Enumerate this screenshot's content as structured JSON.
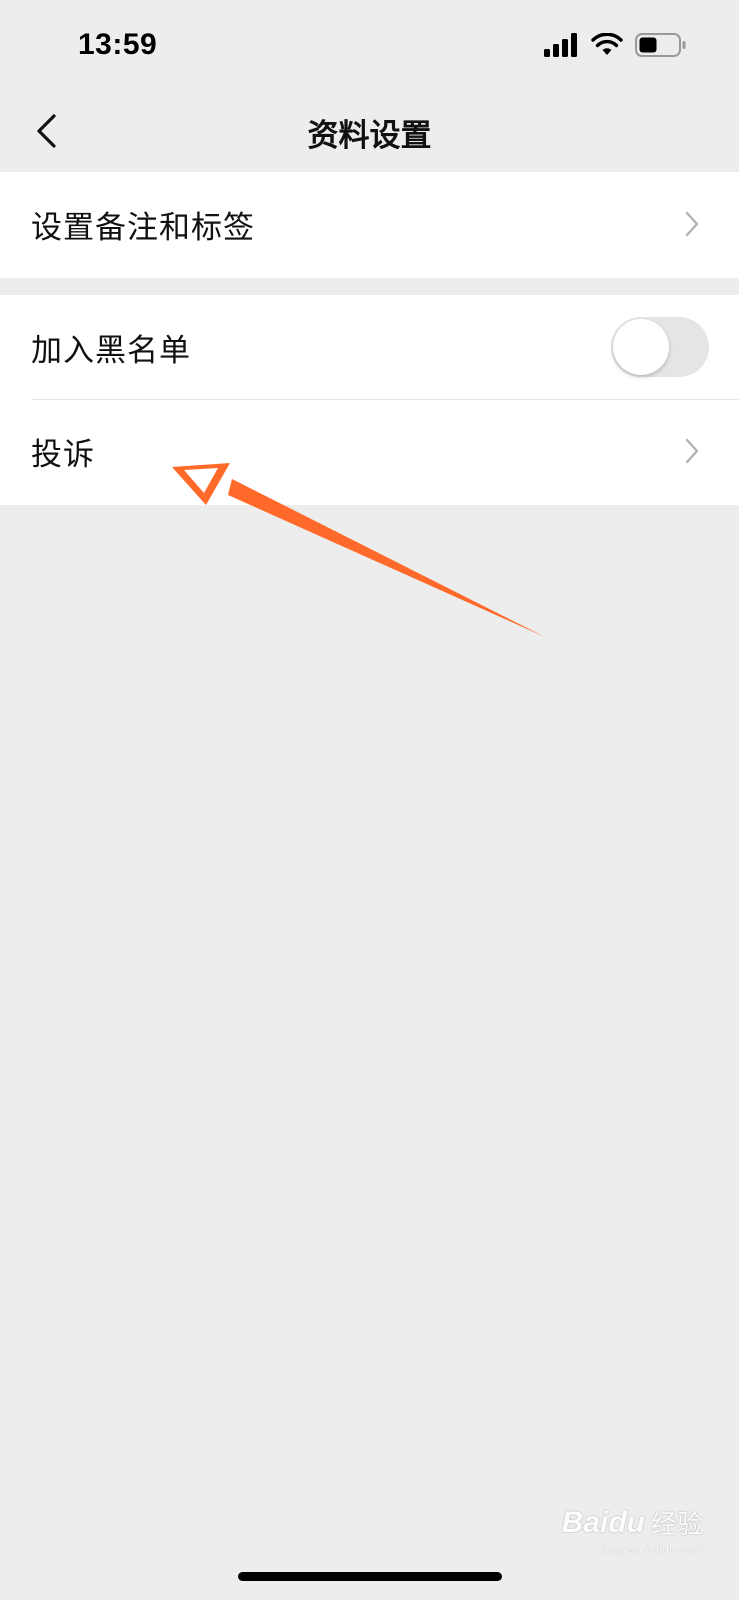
{
  "status_bar": {
    "time": "13:59",
    "icons": [
      "signal-icon",
      "wifi-icon",
      "battery-icon"
    ]
  },
  "nav": {
    "title": "资料设置",
    "back_icon": "back-chevron-icon"
  },
  "groups": [
    {
      "items": [
        {
          "label": "设置备注和标签",
          "accessory": "chevron-right-icon"
        }
      ]
    },
    {
      "items": [
        {
          "label": "加入黑名单",
          "accessory": "toggle",
          "toggle_on": false
        },
        {
          "label": "投诉",
          "accessory": "chevron-right-icon"
        }
      ]
    }
  ],
  "annotation": {
    "icon": "arrow-annotation-icon",
    "color": "#ff6a2b"
  },
  "watermark": {
    "brand": "Baidu",
    "text": "经验",
    "url": "jingyan.baidu.com"
  },
  "colors": {
    "background": "#ededed",
    "cell": "#ffffff",
    "toggle_off": "#e5e5e5"
  }
}
